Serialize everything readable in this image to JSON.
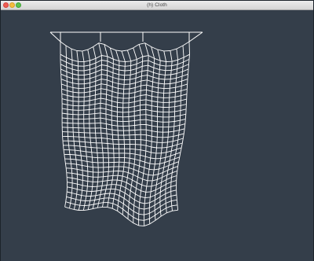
{
  "window": {
    "title": "(h) Cloth"
  },
  "colors": {
    "background": "#343e4a",
    "cloth": "#ffffff",
    "titlebar": "#e0e0e0",
    "close": "#ee5e55",
    "minimize": "#f5bd3f",
    "zoom": "#5fc14f"
  },
  "cloth": {
    "columns": 23,
    "rows": 34,
    "pin_count": 4
  }
}
